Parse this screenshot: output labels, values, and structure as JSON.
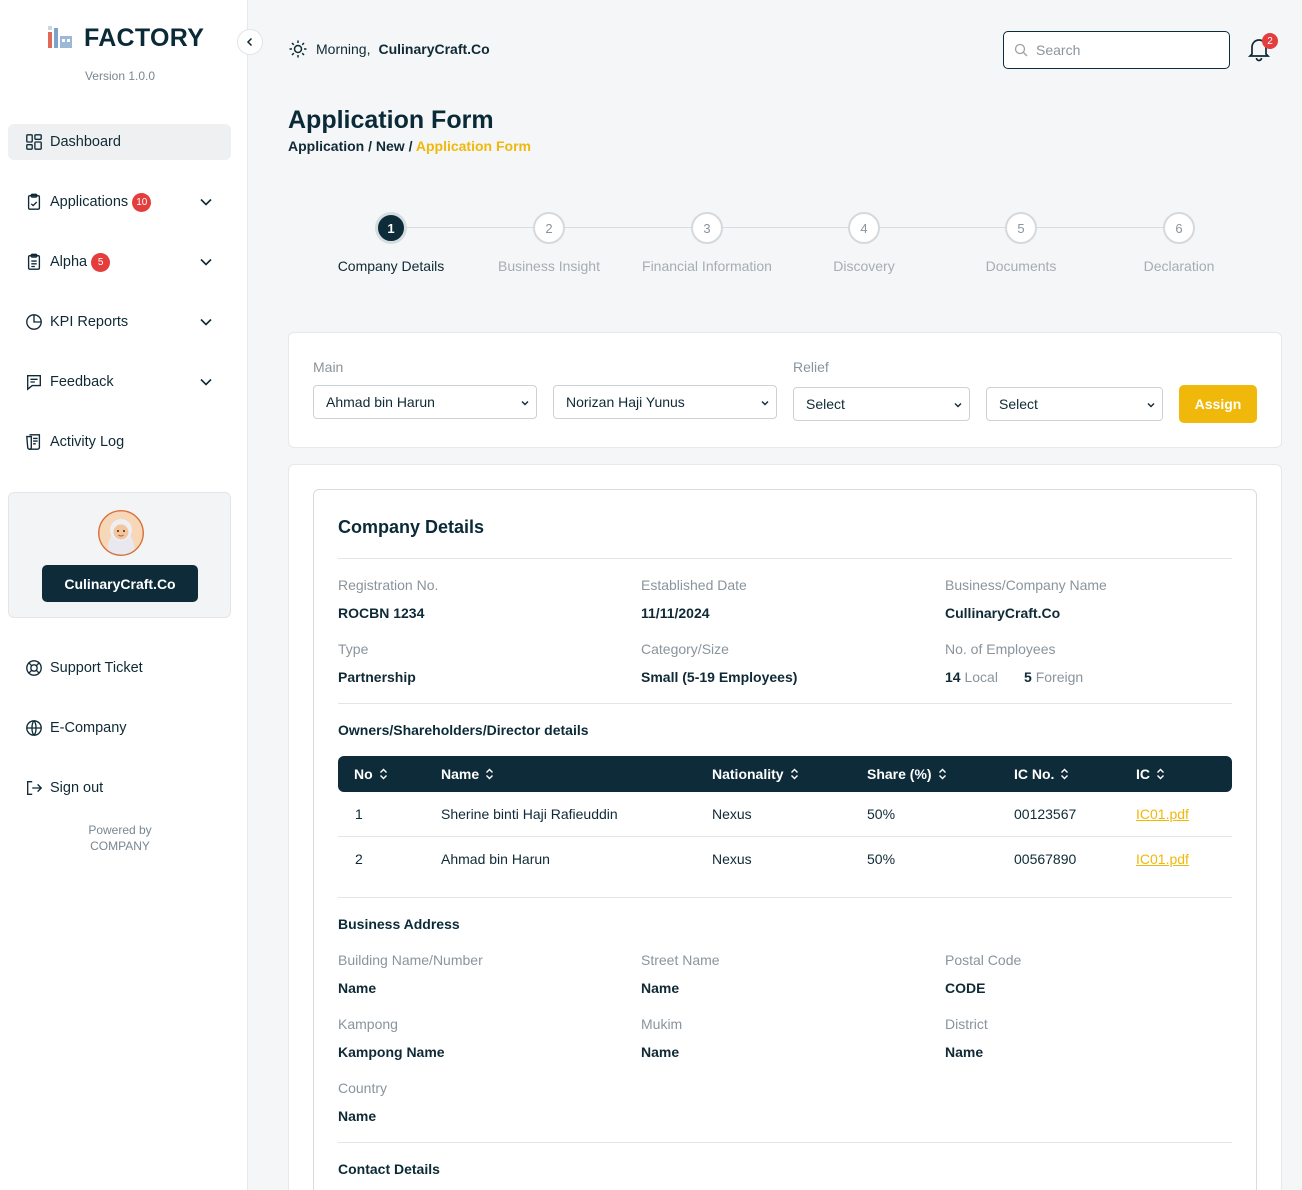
{
  "brand": {
    "name": "FACTORY",
    "version": "Version 1.0.0",
    "powered_line1": "Powered by",
    "powered_line2": "COMPANY"
  },
  "sidebar": {
    "items": [
      {
        "label": "Dashboard",
        "icon": "dashboard-icon"
      },
      {
        "label": "Applications",
        "badge": "10",
        "icon": "clipboard-icon"
      },
      {
        "label": "Alpha",
        "badge": "5",
        "icon": "clipboard-list-icon"
      },
      {
        "label": "KPI Reports",
        "icon": "pie-chart-icon"
      },
      {
        "label": "Feedback",
        "icon": "message-icon"
      },
      {
        "label": "Activity Log",
        "icon": "log-icon"
      }
    ],
    "profile_button": "CulinaryCraft.Co",
    "bottom_items": [
      {
        "label": "Support Ticket",
        "icon": "lifebuoy-icon"
      },
      {
        "label": "E-Company",
        "icon": "globe-icon"
      },
      {
        "label": "Sign out",
        "icon": "sign-out-icon"
      }
    ]
  },
  "header": {
    "greeting": "Morning,",
    "org": "CulinaryCraft.Co",
    "search_placeholder": "Search",
    "notifications": "2"
  },
  "page": {
    "title": "Application Form",
    "crumb_1": "Application",
    "crumb_2": "New",
    "crumb_current": "Application Form"
  },
  "steps": [
    {
      "n": "1",
      "label": "Company Details"
    },
    {
      "n": "2",
      "label": "Business Insight"
    },
    {
      "n": "3",
      "label": "Financial Information"
    },
    {
      "n": "4",
      "label": "Discovery"
    },
    {
      "n": "5",
      "label": "Documents"
    },
    {
      "n": "6",
      "label": "Declaration"
    }
  ],
  "assign": {
    "main_label": "Main",
    "relief_label": "Relief",
    "main_1": "Ahmad bin Harun",
    "main_2": "Norizan Haji Yunus",
    "relief_1": "Select",
    "relief_2": "Select",
    "button": "Assign"
  },
  "company": {
    "title": "Company Details",
    "reg_label": "Registration No.",
    "reg_value": "ROCBN 1234",
    "est_label": "Established Date",
    "est_value": "11/11/2024",
    "name_label": "Business/Company Name",
    "name_value": "CullinaryCraft.Co",
    "type_label": "Type",
    "type_value": "Partnership",
    "cat_label": "Category/Size",
    "cat_value": "Small (5-19 Employees)",
    "emp_label": "No. of Employees",
    "emp_local_n": "14",
    "emp_local": "Local",
    "emp_foreign_n": "5",
    "emp_foreign": "Foreign"
  },
  "owners": {
    "title": "Owners/Shareholders/Director details",
    "columns": [
      "No",
      "Name",
      "Nationality",
      "Share (%)",
      "IC No.",
      "IC"
    ],
    "rows": [
      [
        "1",
        "Sherine binti Haji Rafieuddin",
        "Nexus",
        "50%",
        "00123567",
        "IC01.pdf"
      ],
      [
        "2",
        "Ahmad bin Harun",
        "Nexus",
        "50%",
        "00567890",
        "IC01.pdf"
      ]
    ]
  },
  "address": {
    "title": "Business Address",
    "building_label": "Building Name/Number",
    "building_value": "Name",
    "street_label": "Street Name",
    "street_value": "Name",
    "postal_label": "Postal Code",
    "postal_value": "CODE",
    "kampong_label": "Kampong",
    "kampong_value": "Kampong Name",
    "mukim_label": "Mukim",
    "mukim_value": "Name",
    "district_label": "District",
    "district_value": "Name",
    "country_label": "Country",
    "country_value": "Name"
  },
  "contact": {
    "title": "Contact Details"
  },
  "colors": {
    "primary": "#0d2b38",
    "accent": "#f0b80a",
    "badge": "#e43d3d"
  }
}
